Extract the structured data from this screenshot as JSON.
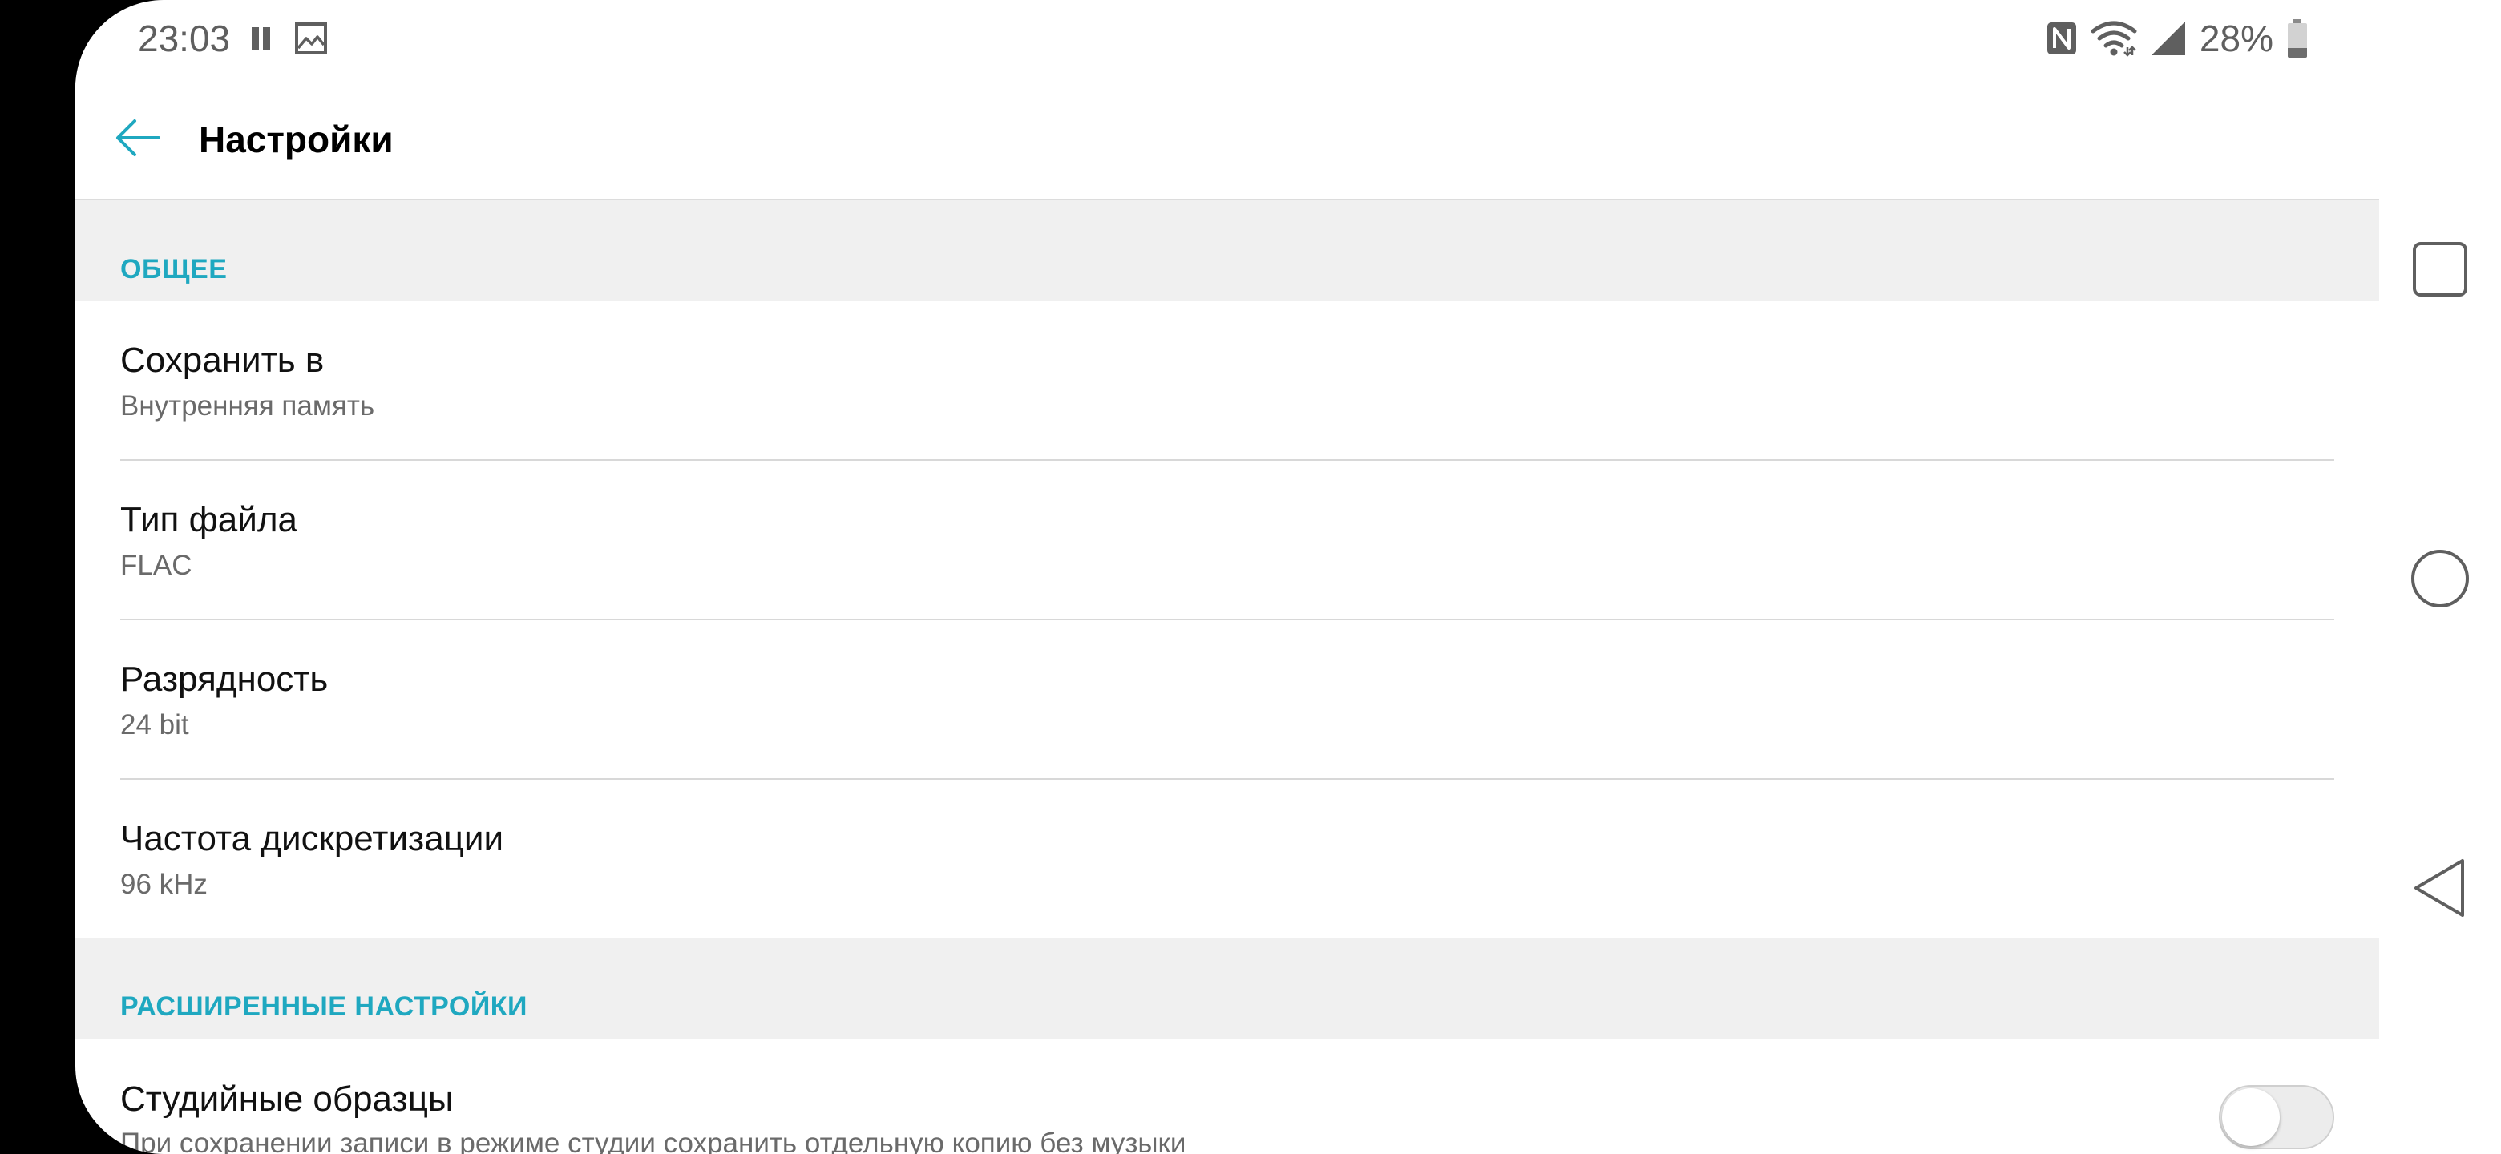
{
  "status_bar": {
    "time": "23:03",
    "battery_text": "28%",
    "battery_level": 0.28,
    "icons": [
      "pause-icon",
      "image-icon",
      "nfc-icon",
      "wifi-icon",
      "signal-icon",
      "battery-icon"
    ]
  },
  "app_bar": {
    "title": "Настройки",
    "back_icon": "arrow-left-icon"
  },
  "sections": [
    {
      "title": "ОБЩЕЕ",
      "items": [
        {
          "title": "Сохранить в",
          "value": "Внутренняя память"
        },
        {
          "title": "Тип файла",
          "value": "FLAC"
        },
        {
          "title": "Разрядность",
          "value": "24 bit"
        },
        {
          "title": "Частота дискретизации",
          "value": "96 kHz"
        }
      ]
    },
    {
      "title": "РАСШИРЕННЫЕ НАСТРОЙКИ",
      "items": [
        {
          "title": "Студийные образцы",
          "value": "При сохранении записи в режиме студии сохранить отдельную копию без музыки",
          "toggle_on": false
        }
      ]
    }
  ],
  "nav_bar": {
    "icons": [
      "recents-icon",
      "home-icon",
      "back-icon"
    ]
  },
  "colors": {
    "accent": "#1fa8c0",
    "section_background": "#f0f0f0",
    "divider": "#d8d8d8",
    "secondary_text": "#6a6a6a"
  }
}
